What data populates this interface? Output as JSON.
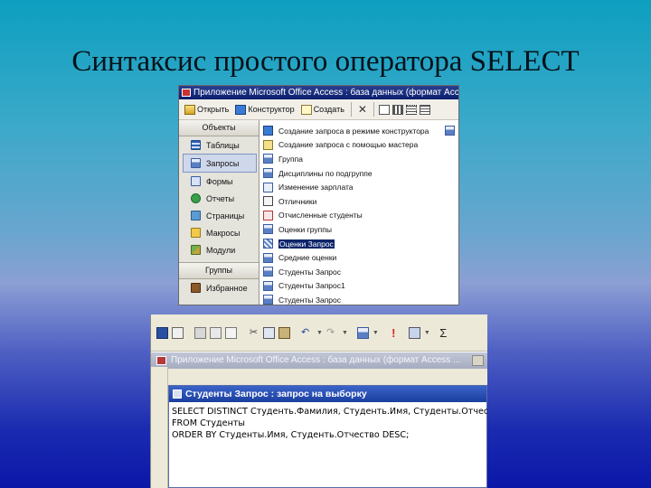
{
  "slide": {
    "title": "Синтаксис простого оператора SELECT"
  },
  "db_window": {
    "title": "Приложение Microsoft Office Access : база данных (формат Access ...",
    "toolbar": {
      "open": "Открыть",
      "designer": "Конструктор",
      "create": "Создать"
    },
    "objects_header": "Объекты",
    "groups_header": "Группы",
    "objects": [
      {
        "label": "Таблицы",
        "icon": "table-icon"
      },
      {
        "label": "Запросы",
        "icon": "query-icon"
      },
      {
        "label": "Формы",
        "icon": "form-icon"
      },
      {
        "label": "Отчеты",
        "icon": "report-icon"
      },
      {
        "label": "Страницы",
        "icon": "page-icon"
      },
      {
        "label": "Макросы",
        "icon": "macro-icon"
      },
      {
        "label": "Модули",
        "icon": "module-icon"
      }
    ],
    "favorites": "Избранное",
    "queries": [
      "Создание запроса в режиме конструктора",
      "Создание запроса с помощью мастера",
      "Группа",
      "Дисциплины по подгруппе",
      "Изменение зарплата",
      "Отличники",
      "Отчисленные студенты",
      "Оценки группы",
      "Оценки Запрос",
      "Средние оценки",
      "Студенты Запрос",
      "Студенты Запрос1",
      "Студенты Запрос"
    ],
    "selected_query_index": 8
  },
  "sql_app": {
    "app_title": "Приложение Microsoft Office Access : база данных (формат Access ...",
    "query_window_title": "Студенты Запрос : запрос на выборку",
    "sql_lines": [
      "SELECT DISTINCT Студенть.Фамилия, Студенть.Имя, Студенты.Отчество",
      "FROM Студенты",
      "ORDER BY Студенты.Имя, Студенть.Отчество DESC;"
    ],
    "toolbar_sigma": "Σ",
    "toolbar_run": "!"
  }
}
